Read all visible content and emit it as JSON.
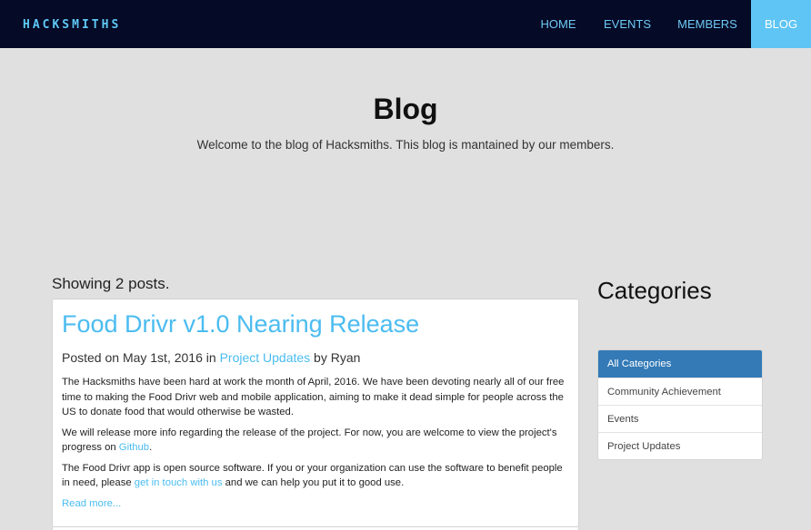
{
  "navbar": {
    "logo": "HACKSMITHS",
    "items": [
      {
        "label": "HOME"
      },
      {
        "label": "EVENTS"
      },
      {
        "label": "MEMBERS"
      },
      {
        "label": "BLOG",
        "active": true
      }
    ]
  },
  "hero": {
    "title": "Blog",
    "subtitle": "Welcome to the blog of Hacksmiths. This blog is mantained by our members."
  },
  "posts": {
    "count_text": "Showing 2 posts.",
    "items": [
      {
        "title": "Food Drivr v1.0 Nearing Release",
        "meta_prefix": "Posted on May 1st, 2016 in ",
        "category": "Project Updates",
        "meta_suffix": " by Ryan",
        "p1": "The Hacksmiths have been hard at work the month of April, 2016.  We have been devoting nearly all of our free time to making the Food Drivr web and mobile application, aiming to make it dead simple for people across the US to donate food that would otherwise be wasted.",
        "p2_prefix": "We will release more info regarding the release of the project.  For now, you are welcome to view the project's progress on ",
        "p2_link": "Github",
        "p2_suffix": ".",
        "p3_prefix": "The Food Drivr app is open source software.  If you or your organization can use the software to benefit people in need, please ",
        "p3_link": "get in touch with us",
        "p3_suffix": " and we can help you put it to good use.",
        "read_more": "Read more..."
      }
    ]
  },
  "sidebar": {
    "heading": "Categories",
    "items": [
      {
        "label": "All Categories",
        "active": true
      },
      {
        "label": "Community Achievement"
      },
      {
        "label": "Events"
      },
      {
        "label": "Project Updates"
      }
    ]
  },
  "colors": {
    "navbar_bg": "#050a26",
    "accent": "#5ec5f5",
    "link": "#4bbcf0",
    "active_category": "#337ab7",
    "page_bg": "#e0e0e0"
  }
}
